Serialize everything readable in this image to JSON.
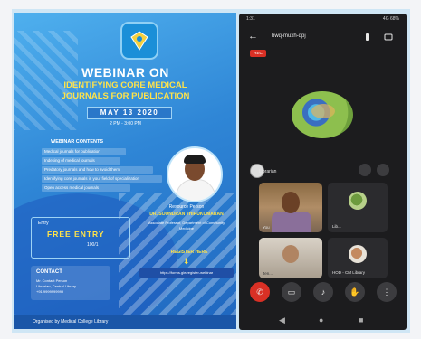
{
  "poster": {
    "heading": "WEBINAR ON",
    "subheading_line1": "IDENTIFYING CORE MEDICAL",
    "subheading_line2": "JOURNALS FOR PUBLICATION",
    "date": "MAY 13 2020",
    "time": "2 PM - 3:00 PM",
    "agenda_title": "WEBINAR CONTENTS",
    "agenda_items": [
      "Medical journals for publication",
      "Indexing of medical journals",
      "Predatory journals and how to avoid them",
      "Identifying core journals in your field of specialization",
      "Open access medical journals"
    ],
    "speaker_intro": "Resource Person",
    "speaker_name": "DR. SOUNDRAN THIRUKUMARAN",
    "speaker_details": "Associate Professor, Department of Community Medicine",
    "entry_label": "Entry",
    "free_entry": "FREE ENTRY",
    "entry_code": "100/1",
    "register_label": "REGISTER HERE",
    "register_link": "https://forms.gle/register-webinar",
    "contact_title": "CONTACT",
    "contact_lines": [
      "Mr. Contact Person",
      "Librarian, Central Library",
      "+91 9999999999"
    ],
    "footer": "Organised by Medical College Library"
  },
  "meet": {
    "status_time": "1:31",
    "status_right": "4G 68%",
    "meeting_title": "bwq-muxh-qpj",
    "rec_label": "REC",
    "main_participant": "Librarian",
    "participants": [
      {
        "name": "You"
      },
      {
        "name": "Lib..."
      },
      {
        "name": "Jen..."
      },
      {
        "name": "HOD - CM Library"
      }
    ],
    "controls": [
      "end-call",
      "camera",
      "microphone",
      "hand-raise",
      "more"
    ]
  },
  "colors": {
    "poster_blue": "#2f86d6",
    "accent_yellow": "#ffe34a",
    "meet_bg": "#1c1c1e",
    "end_red": "#d93025"
  }
}
